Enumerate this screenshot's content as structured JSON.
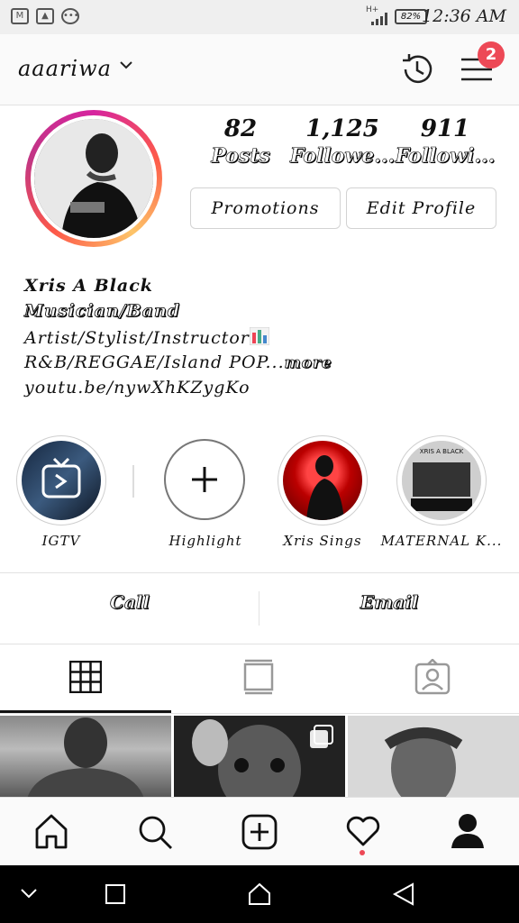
{
  "status_bar": {
    "time": "12:36 AM",
    "battery": "82%",
    "network": "H+",
    "icons": [
      "gmail-icon",
      "gallery-icon",
      "more-dots-icon"
    ]
  },
  "header": {
    "username": "aaariwa",
    "notification_count": "2"
  },
  "profile": {
    "stats": [
      {
        "value": "82",
        "label": "Posts"
      },
      {
        "value": "1,125",
        "label": "Followe..."
      },
      {
        "value": "911",
        "label": "Followi..."
      }
    ],
    "buttons": {
      "promotions": "Promotions",
      "edit_profile": "Edit Profile"
    },
    "bio": {
      "name": "Xris A Black",
      "category": "Musician/Band",
      "line1": "Artist/Stylist/Instructor",
      "line2": "R&B/REGGAE/Island POP...",
      "more": "more",
      "link": "youtu.be/nywXhKZygKo"
    }
  },
  "highlights": [
    {
      "label": "IGTV"
    },
    {
      "label": "Highlight"
    },
    {
      "label": "Xris Sings"
    },
    {
      "label": "MATERNAL K..."
    }
  ],
  "highlight_thumbnail_text": "XRIS A BLACK",
  "contact": {
    "call": "Call",
    "email": "Email"
  },
  "colors": {
    "badge": "#ed4956",
    "divider": "#e2e2e2",
    "activity_dot": "#ed4956"
  }
}
